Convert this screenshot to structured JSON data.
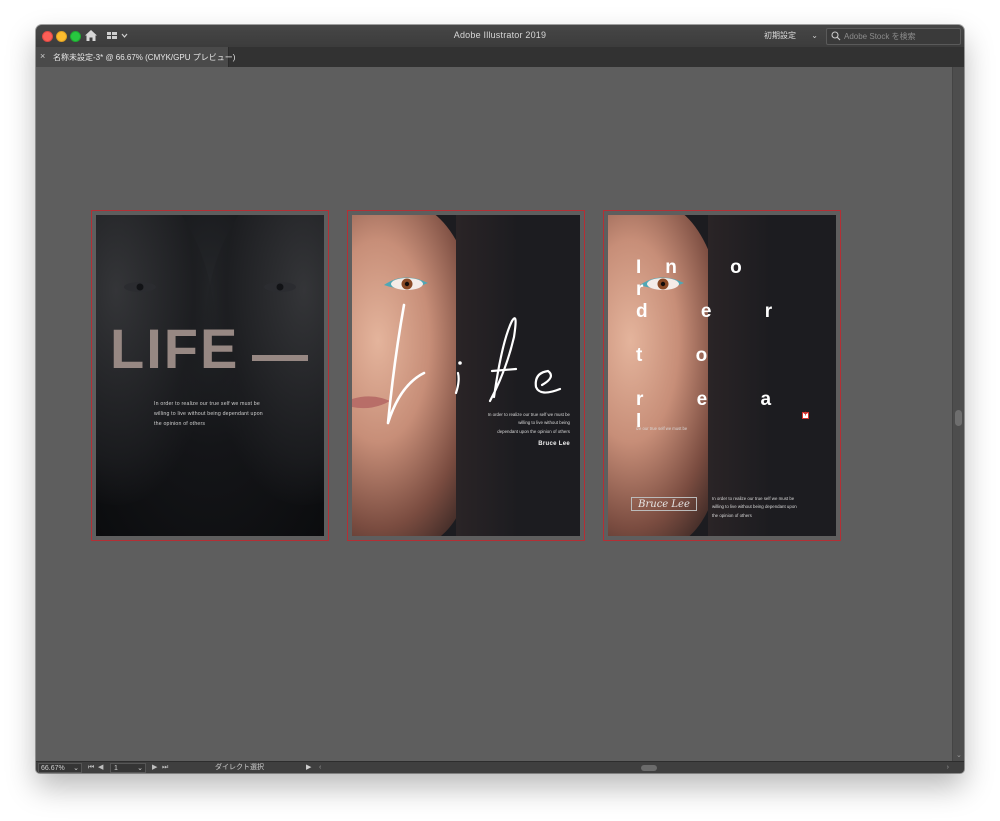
{
  "window": {
    "title": "Adobe Illustrator 2019",
    "workspace_preset": "初期設定",
    "stock_search_placeholder": "Adobe Stock を検索"
  },
  "tabs": [
    {
      "label": "名称未設定-3* @ 66.67% (CMYK/GPU プレビュー)",
      "close": "×"
    }
  ],
  "status": {
    "zoom": "66.67%",
    "page": "1",
    "tool": "ダイレクト選択"
  },
  "colors": {
    "artboard_outline": "#b42f35",
    "canvas": "#5e5e5e"
  },
  "artboards": [
    {
      "heading": "LIFE",
      "quote_lines": [
        "In order to realize our true self we must be",
        "willing to live without being dependant upon",
        "the opinion of others"
      ]
    },
    {
      "script_title": "Life",
      "quote_lines": [
        "In order to realize our true self we must be",
        "willing to live without being",
        "dependant upon the opinion of others"
      ],
      "author": "Bruce Lee"
    },
    {
      "headline_lines": [
        "In o r",
        "d e r",
        "t o",
        "r e a l"
      ],
      "overflow_line": "ize our true self we must be",
      "signature": "Bruce Lee",
      "quote_lines": [
        "In order to realize our true self we must be",
        "willing to live without being dependant upon",
        "the opinion of others"
      ]
    }
  ]
}
